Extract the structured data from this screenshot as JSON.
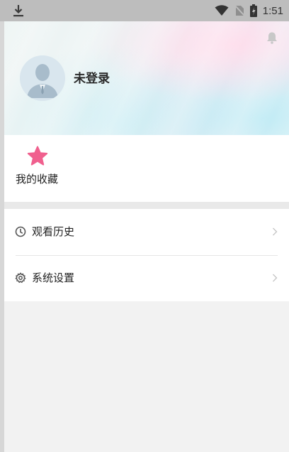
{
  "status_bar": {
    "time": "1:51",
    "icons": [
      "download-icon",
      "wifi-icon",
      "no-sim-icon",
      "battery-icon"
    ]
  },
  "profile": {
    "username": "未登录",
    "avatar_icon": "default-avatar-icon",
    "notification_icon": "bell-icon"
  },
  "favorites": {
    "label": "我的收藏",
    "icon": "star-icon",
    "icon_color": "#f0608e"
  },
  "menu": {
    "items": [
      {
        "label": "观看历史",
        "icon": "clock-icon"
      },
      {
        "label": "系统设置",
        "icon": "gear-icon"
      }
    ]
  }
}
